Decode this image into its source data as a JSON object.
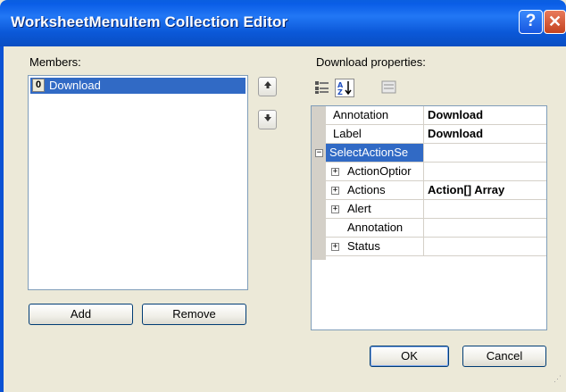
{
  "window": {
    "title": "WorksheetMenuItem Collection Editor"
  },
  "members": {
    "label": "Members:",
    "items": [
      {
        "index": "0",
        "label": "Download"
      }
    ]
  },
  "buttons": {
    "add": "Add",
    "remove": "Remove",
    "ok": "OK",
    "cancel": "Cancel"
  },
  "properties": {
    "label": "Download properties:",
    "rows": [
      {
        "name": "Annotation",
        "value": "Download",
        "expander": "",
        "type": "prop"
      },
      {
        "name": "Label",
        "value": "Download",
        "expander": "",
        "type": "prop"
      },
      {
        "name": "SelectActionSe",
        "value": "",
        "expander": "−",
        "type": "category"
      },
      {
        "name": "ActionOptior",
        "value": "",
        "expander": "+",
        "type": "prop"
      },
      {
        "name": "Actions",
        "value": "Action[] Array",
        "expander": "+",
        "type": "prop"
      },
      {
        "name": "Alert",
        "value": "",
        "expander": "+",
        "type": "prop"
      },
      {
        "name": "Annotation",
        "value": "",
        "expander": "",
        "type": "prop"
      },
      {
        "name": "Status",
        "value": "",
        "expander": "+",
        "type": "prop"
      }
    ]
  },
  "icons": {
    "help": "?",
    "close": "✕",
    "move_up": "🡅",
    "move_down": "🡇"
  },
  "colors": {
    "titlebar": "#0a5de6",
    "selection": "#316ac5",
    "dialog_bg": "#ece9d8"
  }
}
